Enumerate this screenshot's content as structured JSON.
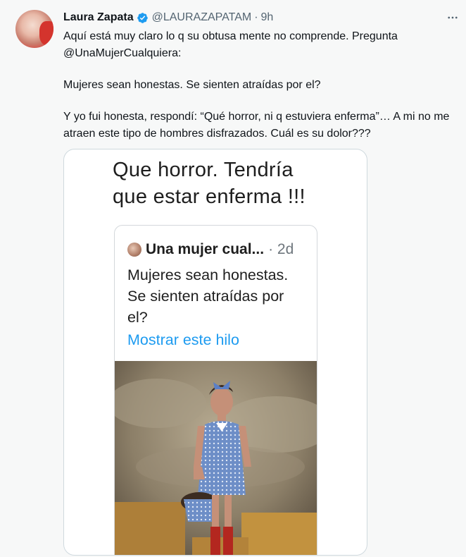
{
  "tweet": {
    "author_name": "Laura Zapata",
    "handle": "@LAURAZAPATAM",
    "separator": "·",
    "time": "9h",
    "lines": [
      "Aquí está muy claro lo q su obtusa mente no comprende. Pregunta",
      "@UnaMujerCualquiera:",
      "Mujeres sean honestas. Se sienten atraídas por el?",
      "Y yo fui honesta, respondí: “Qué horror, ni q estuviera enferma”… A mi no me atraen este tipo de hombres disfrazados. Cuál es su dolor???"
    ]
  },
  "media": {
    "caption_line1": "Que horror. Tendría",
    "caption_line2": "que estar enferma !!!",
    "quoted": {
      "name": "Una mujer cual...",
      "time": "· 2d",
      "text_line1": "Mujeres sean honestas.",
      "text_line2": "Se sienten atraídas por",
      "text_line3": "el?",
      "link": "Mostrar este hilo"
    }
  },
  "icons": {
    "verified": "verified-badge-icon",
    "more": "more-options-icon"
  },
  "colors": {
    "link_blue": "#1d9bf0",
    "secondary_text": "#536471",
    "primary_text": "#0f1419"
  }
}
